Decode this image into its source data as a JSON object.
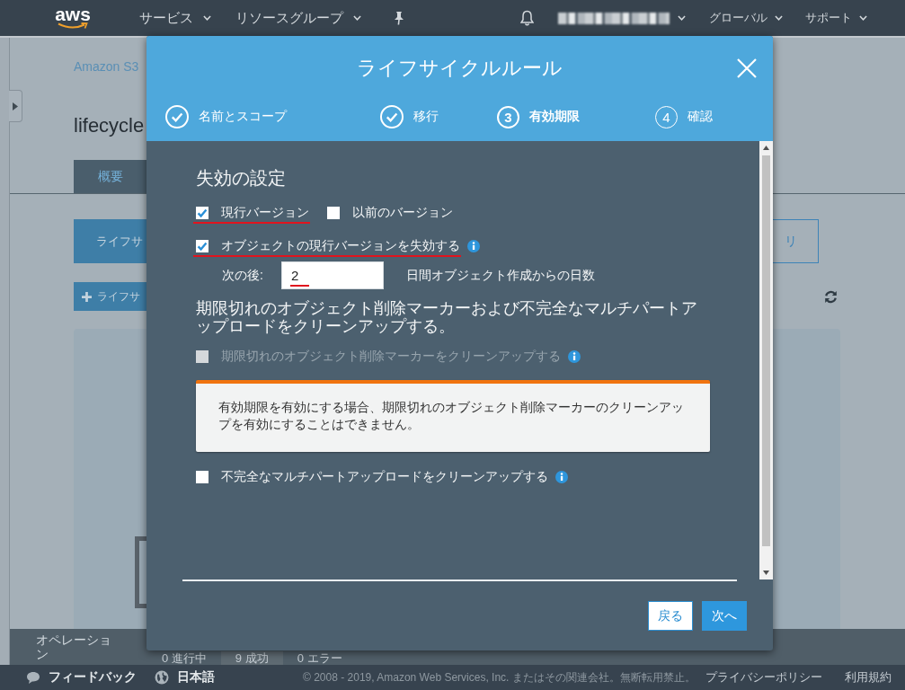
{
  "top_nav": {
    "logo": "aws",
    "menus": [
      {
        "label": "サービス"
      },
      {
        "label": "リソースグループ"
      }
    ],
    "right_menus": [
      {
        "label": "グローバル"
      },
      {
        "label": "サポート"
      }
    ]
  },
  "page": {
    "breadcrumb": "Amazon S3",
    "title": "lifecycle",
    "tabs": [
      {
        "label": "概要",
        "selected": true
      }
    ],
    "lifecycle_button": "ライフサ",
    "right_button": "リ",
    "add_button": "ライフサ"
  },
  "operations_bar": {
    "label": "オペレーション",
    "counts": [
      {
        "label": "0 進行中",
        "selected": false
      },
      {
        "label": "9 成功",
        "selected": true
      },
      {
        "label": "0 エラー",
        "selected": false
      }
    ]
  },
  "footer": {
    "feedback": "フィードバック",
    "language": "日本語",
    "copyright": "© 2008 - 2019, Amazon Web Services, Inc. またはその関連会社。無断転用禁止。",
    "links": [
      "プライバシーポリシー",
      "利用規約"
    ]
  },
  "dialog": {
    "title": "ライフサイクルルール",
    "steps": [
      {
        "label": "名前とスコープ",
        "completed": true,
        "selected": false
      },
      {
        "label": "移行",
        "completed": true,
        "selected": false
      },
      {
        "number": "3",
        "label": "有効期限",
        "completed": false,
        "selected": true
      },
      {
        "number": "4",
        "label": "確認",
        "completed": false,
        "selected": false
      }
    ],
    "section_title": "失効の設定",
    "version_options": [
      {
        "label": "現行バージョン",
        "checked": true,
        "underlined": true
      },
      {
        "label": "以前のバージョン",
        "checked": false,
        "underlined": false
      }
    ],
    "expire_option": {
      "label": "オブジェクトの現行バージョンを失効する",
      "checked": true,
      "underlined": true
    },
    "days_field": {
      "label": "次の後:",
      "value": "2",
      "value_underlined": true,
      "suffix": "日間オブジェクト作成からの日数"
    },
    "cleanup_title": "期限切れのオブジェクト削除マーカーおよび不完全なマルチパートアップロードをクリーンアップする。",
    "delete_marker_option": {
      "label": "期限切れのオブジェクト削除マーカーをクリーンアップする",
      "checked": false,
      "disabled": true
    },
    "warning": "有効期限を有効にする場合、期限切れのオブジェクト削除マーカーのクリーンアップを有効にすることはできません。",
    "multipart_option": {
      "label": "不完全なマルチパートアップロードをクリーンアップする",
      "checked": false,
      "disabled": false
    },
    "buttons": [
      {
        "label": "戻る",
        "kind": "secondary"
      },
      {
        "label": "次へ",
        "kind": "primary"
      }
    ]
  }
}
